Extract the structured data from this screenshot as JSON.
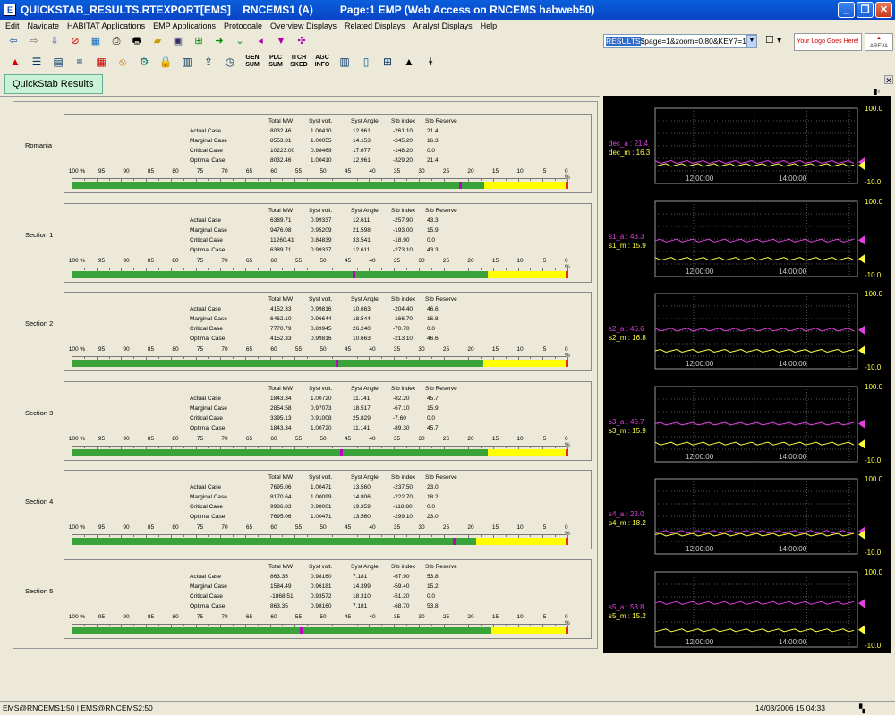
{
  "window": {
    "title": "QUICKSTAB_RESULTS.RTEXPORT[EMS]    RNCEMS1 (A)         Page:1 EMP (Web Access on RNCEMS habweb50)"
  },
  "menu": [
    "Edit",
    "Navigate",
    "HABITAT Applications",
    "EMP Applications",
    "Protocoale",
    "Overview Displays",
    "Related Displays",
    "Analyst Displays",
    "Help"
  ],
  "toolbar": {
    "url_prefix": "RESULTS",
    "url": "$page=1&zoom=0.80&KEY7=1",
    "logo_text": "Your Logo Goes Here!",
    "brand": "AREVA",
    "buttons": [
      {
        "name": "gen-sum",
        "label1": "GEN",
        "label2": "SUM"
      },
      {
        "name": "plc-sum",
        "label1": "PLC",
        "label2": "SUM"
      },
      {
        "name": "itch-sked",
        "label1": "ITCH",
        "label2": "SKED"
      },
      {
        "name": "agc-info",
        "label1": "AGC",
        "label2": "INFO"
      }
    ]
  },
  "tab": {
    "label": "QuickStab Results"
  },
  "columns": [
    "Total MW",
    "Syst volt.",
    "Syst Angle",
    "Stb index",
    "Stb Reserve"
  ],
  "scale_labels": [
    "100 %",
    "95",
    "90",
    "85",
    "80",
    "75",
    "70",
    "65",
    "60",
    "55",
    "50",
    "45",
    "40",
    "35",
    "30",
    "25",
    "20",
    "15",
    "10",
    "5",
    "0 %"
  ],
  "sections": [
    {
      "name": "Romania",
      "rows": [
        [
          "Actual Case",
          "8032.46",
          "1.00410",
          "12.961",
          "-261.10",
          "21.4"
        ],
        [
          "Marginal Case",
          "8553.31",
          "1.00055",
          "14.153",
          "-245.20",
          "16.3"
        ],
        [
          "Critical Case",
          "10223.00",
          "0.98469",
          "17.677",
          "-148.20",
          "0.0"
        ],
        [
          "Optimal Case",
          "8032.46",
          "1.00410",
          "12.961",
          "-329.20",
          "21.4"
        ]
      ],
      "green": 0.833,
      "marker": 0.783
    },
    {
      "name": "Section 1",
      "rows": [
        [
          "Actual Case",
          "6389.71",
          "0.99337",
          "12.611",
          "-257.90",
          "43.3"
        ],
        [
          "Marginal Case",
          "9476.08",
          "0.95209",
          "21.598",
          "-193.00",
          "15.9"
        ],
        [
          "Critical Case",
          "11260.41",
          "0.84839",
          "33.541",
          "-18.90",
          "0.0"
        ],
        [
          "Optimal Case",
          "6389.71",
          "0.99337",
          "12.611",
          "-273.10",
          "43.3"
        ]
      ],
      "green": 0.841,
      "marker": 0.567
    },
    {
      "name": "Section 2",
      "rows": [
        [
          "Actual Case",
          "4152.33",
          "0.99816",
          "10.663",
          "-204.40",
          "46.6"
        ],
        [
          "Marginal Case",
          "6462.10",
          "0.96644",
          "18.544",
          "-166.70",
          "16.8"
        ],
        [
          "Critical Case",
          "7770.79",
          "0.89945",
          "26.240",
          "-70.70",
          "0.0"
        ],
        [
          "Optimal Case",
          "4152.33",
          "0.99816",
          "10.663",
          "-213.10",
          "46.6"
        ]
      ],
      "green": 0.832,
      "marker": 0.534
    },
    {
      "name": "Section 3",
      "rows": [
        [
          "Actual Case",
          "1843.34",
          "1.00720",
          "11.141",
          "-82.20",
          "45.7"
        ],
        [
          "Marginal Case",
          "2854.58",
          "0.97073",
          "18.517",
          "-67.10",
          "15.9"
        ],
        [
          "Critical Case",
          "3395.13",
          "0.91008",
          "25.829",
          "-7.60",
          "0.0"
        ],
        [
          "Optimal Case",
          "1843.34",
          "1.00720",
          "11.141",
          "-89.30",
          "45.7"
        ]
      ],
      "green": 0.841,
      "marker": 0.543
    },
    {
      "name": "Section 4",
      "rows": [
        [
          "Actual Case",
          "7695.06",
          "1.00471",
          "13.560",
          "-237.50",
          "23.0"
        ],
        [
          "Marginal Case",
          "8170.64",
          "1.00099",
          "14.806",
          "-222.70",
          "18.2"
        ],
        [
          "Critical Case",
          "9986.83",
          "0.98001",
          "19.359",
          "-118.80",
          "0.0"
        ],
        [
          "Optimal Case",
          "7695.06",
          "1.00471",
          "13.560",
          "-299.10",
          "23.0"
        ]
      ],
      "green": 0.818,
      "marker": 0.77
    },
    {
      "name": "Section 5",
      "rows": [
        [
          "Actual Case",
          "863.35",
          "0.98160",
          "7.181",
          "-67.90",
          "53.8"
        ],
        [
          "Marginal Case",
          "1584.49",
          "0.96181",
          "14.399",
          "-59.40",
          "15.2"
        ],
        [
          "Critical Case",
          "-1868.51",
          "0.93572",
          "18.310",
          "-51.20",
          "0.0"
        ],
        [
          "Optimal Case",
          "863.35",
          "0.98160",
          "7.181",
          "-68.70",
          "53.8"
        ]
      ],
      "green": 0.848,
      "marker": 0.462
    }
  ],
  "trends": [
    {
      "a_label": "dec_a : 21.4",
      "m_label": "dec_m : 16.3",
      "a_level": 0.214,
      "m_level": 0.163
    },
    {
      "a_label": "s1_a : 43.3",
      "m_label": "s1_m : 15.9",
      "a_level": 0.433,
      "m_level": 0.159
    },
    {
      "a_label": "s2_a : 46.6",
      "m_label": "s2_m : 16.8",
      "a_level": 0.466,
      "m_level": 0.168
    },
    {
      "a_label": "s3_a : 45.7",
      "m_label": "s3_m : 15.9",
      "a_level": 0.457,
      "m_level": 0.159
    },
    {
      "a_label": "s4_a : 23.0",
      "m_label": "s4_m : 18.2",
      "a_level": 0.23,
      "m_level": 0.182
    },
    {
      "a_label": "s5_a : 53.8",
      "m_label": "s5_m : 15.2",
      "a_level": 0.538,
      "m_level": 0.152
    }
  ],
  "trend_axis": {
    "ymax": "100.0",
    "ymin": "-10.0",
    "x_ticks": [
      "12:00:00",
      "14:00:00"
    ]
  },
  "colors": {
    "green": "#3aa33a",
    "yellow": "#ffff00",
    "magenta": "#c000c0",
    "trend_a": "#e040e0",
    "trend_m": "#ffff40"
  },
  "status": {
    "left": "EMS@RNCEMS1:50 | EMS@RNCEMS2:50",
    "right": "14/03/2006 15:04:33"
  }
}
